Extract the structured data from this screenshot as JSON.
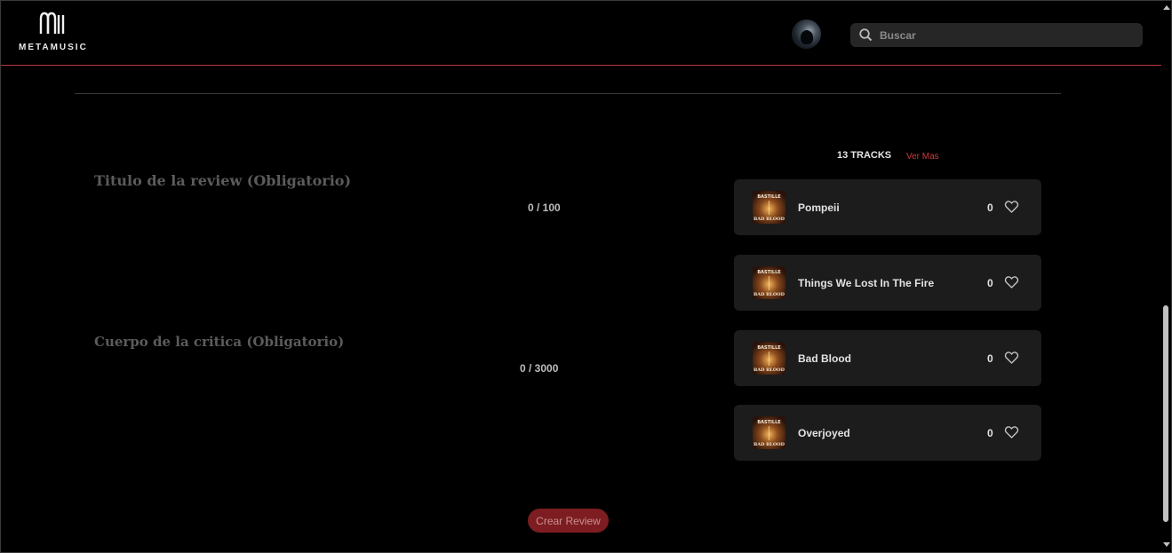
{
  "app": {
    "logo_text": "METAMUSIC"
  },
  "header": {
    "avatar_icon": "user-avatar",
    "search": {
      "placeholder": "Buscar",
      "value": "",
      "icon": "search-icon"
    }
  },
  "review_form": {
    "title_label": "Titulo de la review (Obligatorio)",
    "title_counter": "0 / 100",
    "body_label": "Cuerpo de la critica (Obligatorio)",
    "body_counter": "0 / 3000",
    "submit_label": "Crear Review"
  },
  "tracks": {
    "heading": "13 TRACKS",
    "see_more": "Ver Mas",
    "items": [
      {
        "name": "Pompeii",
        "likes": "0"
      },
      {
        "name": "Things We Lost In The Fire",
        "likes": "0"
      },
      {
        "name": "Bad Blood",
        "likes": "0"
      },
      {
        "name": "Overjoyed",
        "likes": "0"
      }
    ],
    "cover_text": {
      "artist": "BASTILLE",
      "album": "BAD BLOOD"
    }
  },
  "colors": {
    "accent": "#c9393f",
    "button_bg": "#7d1d21",
    "card_bg": "#1c1c1c",
    "page_bg": "#000000"
  }
}
